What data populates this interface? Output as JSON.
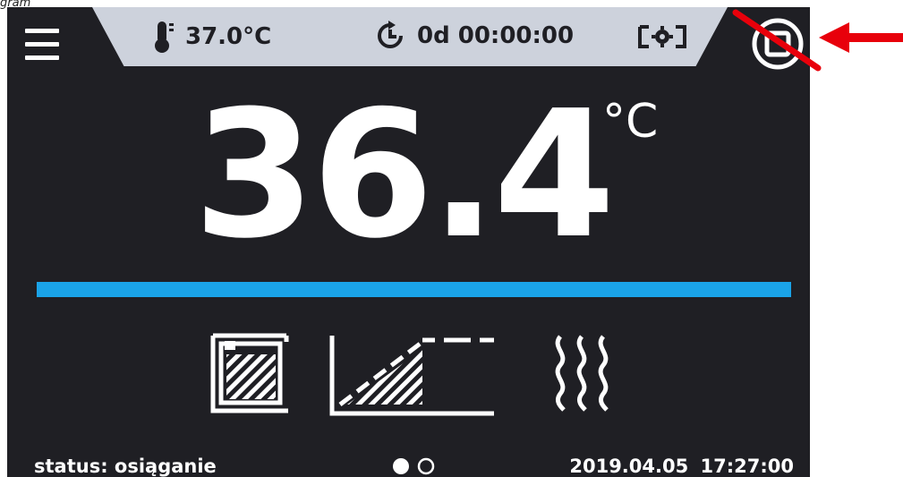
{
  "caption": "gram",
  "topbar": {
    "setpoint_temp": "37.0°C",
    "timer": "0d 00:00:00",
    "thermometer_icon": "thermometer-icon",
    "clock_icon": "clock-icon",
    "settings_icon": "gear-icon"
  },
  "main": {
    "temperature": "36.4",
    "unit": "°C",
    "progress_fraction": 1.0
  },
  "modes": [
    "chamber-icon",
    "ramp-icon",
    "heating-icon"
  ],
  "footer": {
    "status": "status: osiąganie",
    "datetime": "2019.04.05 17:27:00",
    "page_dots_active": 1
  },
  "colors": {
    "background": "#1f1f24",
    "topbar": "#cdd2dc",
    "progress": "#1aa3e8",
    "annotation": "#e8000b"
  }
}
